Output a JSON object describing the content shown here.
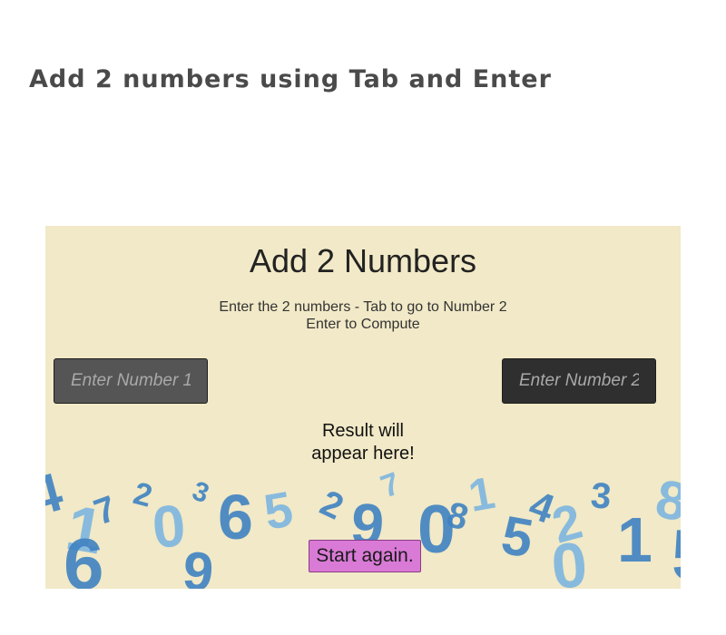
{
  "page": {
    "title": "Add 2 numbers using Tab and Enter"
  },
  "app": {
    "title": "Add 2 Numbers",
    "instructions": {
      "line1": "Enter the 2 numbers - Tab to go to Number 2",
      "line2": "Enter to Compute"
    },
    "input1": {
      "placeholder": "Enter Number 1",
      "value": ""
    },
    "input2": {
      "placeholder": "Enter Number 2",
      "value": ""
    },
    "result": {
      "line1": "Result will",
      "line2": "appear here!"
    },
    "start_again_label": "Start again."
  },
  "colors": {
    "panel_bg": "#f1e9c7",
    "number_blue": "#3f82c2",
    "number_light_blue": "#7db6e0",
    "button_bg": "#d97ad6"
  },
  "background_digits": [
    "4",
    "1",
    "7",
    "2",
    "0",
    "3",
    "6",
    "5",
    "2",
    "9",
    "7",
    "0",
    "8",
    "1",
    "5",
    "4",
    "2",
    "3",
    "1",
    "8",
    "6",
    "9",
    "0",
    "5"
  ]
}
